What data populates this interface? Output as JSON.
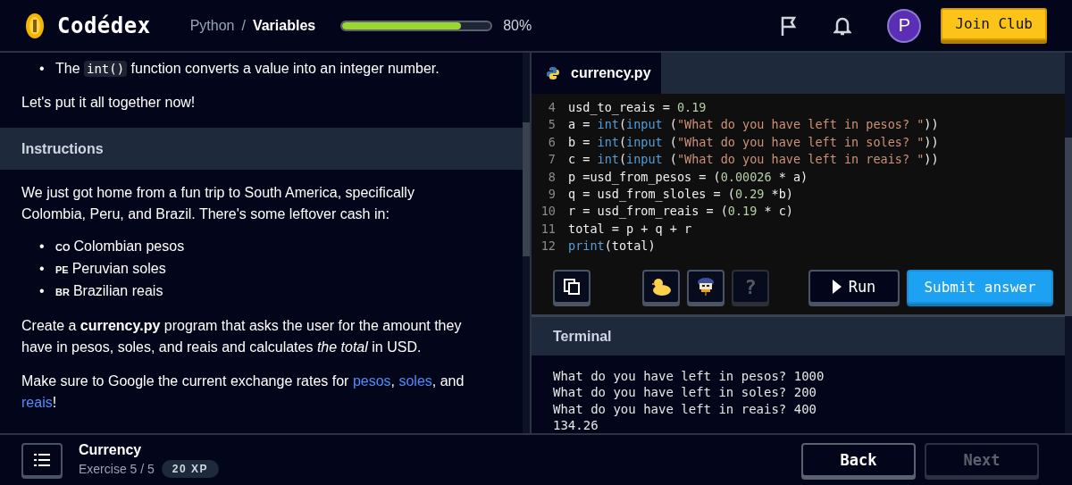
{
  "header": {
    "brand": "Codédex",
    "breadcrumb_separator": "/",
    "breadcrumb": [
      {
        "label": "Python",
        "current": false
      },
      {
        "label": "Variables",
        "current": true
      }
    ],
    "progress": {
      "level": 0.8,
      "reading": "80%"
    },
    "avatar": "P",
    "join_button": "Join Club"
  },
  "lesson": {
    "bullet_marker": "•",
    "bullet": [
      {
        "kind": "text",
        "text": "The "
      },
      {
        "kind": "code",
        "text": "int()"
      },
      {
        "kind": "text",
        "text": " function converts a value into an integer number."
      }
    ],
    "intro": "Let's put it all together now!",
    "section_title": "Instructions",
    "paragraph": "We just got home from a fun trip to South America, specifically Colombia, Peru, and Brazil. There's some leftover cash in:",
    "currencies": [
      {
        "flag": "CO",
        "label": "Colombian pesos"
      },
      {
        "flag": "PE",
        "label": "Peruvian soles"
      },
      {
        "flag": "BR",
        "label": "Brazilian reais"
      }
    ],
    "task": "Create a **currency.py** program that asks the user for the amount they have in pesos, soles, and reais and calculates *the total* in USD.",
    "note": [
      {
        "kind": "text",
        "text": "Make sure to Google the current exchange rates for "
      },
      {
        "kind": "link",
        "text": "pesos"
      },
      {
        "kind": "text",
        "text": ", "
      },
      {
        "kind": "link",
        "text": "soles"
      },
      {
        "kind": "text",
        "text": ", and "
      },
      {
        "kind": "link",
        "text": "reais"
      },
      {
        "kind": "text",
        "text": "!"
      }
    ]
  },
  "editor": {
    "tab": "currency.py",
    "lines": [
      {
        "n": "4",
        "tokens": [
          {
            "kind": "plain",
            "text": "usd_to_reais = "
          },
          {
            "kind": "number",
            "text": "0.19"
          }
        ]
      },
      {
        "n": "5",
        "tokens": [
          {
            "kind": "plain",
            "text": "a = "
          },
          {
            "kind": "builtin",
            "text": "int"
          },
          {
            "kind": "plain",
            "text": "("
          },
          {
            "kind": "builtin",
            "text": "input"
          },
          {
            "kind": "plain",
            "text": " ("
          },
          {
            "kind": "string",
            "text": "\"What do you have left in pesos? \""
          },
          {
            "kind": "plain",
            "text": "))"
          }
        ]
      },
      {
        "n": "6",
        "tokens": [
          {
            "kind": "plain",
            "text": "b = "
          },
          {
            "kind": "builtin",
            "text": "int"
          },
          {
            "kind": "plain",
            "text": "("
          },
          {
            "kind": "builtin",
            "text": "input"
          },
          {
            "kind": "plain",
            "text": " ("
          },
          {
            "kind": "string",
            "text": "\"What do you have left in soles? \""
          },
          {
            "kind": "plain",
            "text": "))"
          }
        ]
      },
      {
        "n": "7",
        "tokens": [
          {
            "kind": "plain",
            "text": "c = "
          },
          {
            "kind": "builtin",
            "text": "int"
          },
          {
            "kind": "plain",
            "text": "("
          },
          {
            "kind": "builtin",
            "text": "input"
          },
          {
            "kind": "plain",
            "text": " ("
          },
          {
            "kind": "string",
            "text": "\"What do you have left in reais? \""
          },
          {
            "kind": "plain",
            "text": "))"
          }
        ]
      },
      {
        "n": "8",
        "tokens": [
          {
            "kind": "plain",
            "text": "p =usd_from_pesos = ("
          },
          {
            "kind": "number",
            "text": "0.00026"
          },
          {
            "kind": "plain",
            "text": " * a)"
          }
        ]
      },
      {
        "n": "9",
        "tokens": [
          {
            "kind": "plain",
            "text": "q = usd_from_sloles = ("
          },
          {
            "kind": "number",
            "text": "0.29"
          },
          {
            "kind": "plain",
            "text": " *b)"
          }
        ]
      },
      {
        "n": "10",
        "tokens": [
          {
            "kind": "plain",
            "text": "r = usd_from_reais = ("
          },
          {
            "kind": "number",
            "text": "0.19"
          },
          {
            "kind": "plain",
            "text": " * c)"
          }
        ]
      },
      {
        "n": "11",
        "tokens": [
          {
            "kind": "plain",
            "text": "total = p + q + r"
          }
        ]
      },
      {
        "n": "12",
        "tokens": [
          {
            "kind": "builtin",
            "text": "print"
          },
          {
            "kind": "plain",
            "text": "(total)"
          }
        ]
      }
    ],
    "tools": [
      {
        "kind": "copy",
        "disabled": false
      },
      {
        "kind": "duck",
        "disabled": false
      },
      {
        "kind": "helper",
        "disabled": false
      },
      {
        "kind": "help",
        "label": "?",
        "disabled": true
      }
    ],
    "run_button": "Run",
    "submit_button": "Submit answer"
  },
  "terminal": {
    "title": "Terminal",
    "output": [
      "What do you have left in pesos? 1000",
      "What do you have left in soles? 200",
      "What do you have left in reais? 400",
      "134.26"
    ]
  },
  "footer": {
    "title": "Currency",
    "exercise": "Exercise 5 / 5",
    "xp": "20 XP",
    "buttons": [
      {
        "label": "Back",
        "disabled": false
      },
      {
        "label": "Next",
        "disabled": true
      }
    ]
  }
}
